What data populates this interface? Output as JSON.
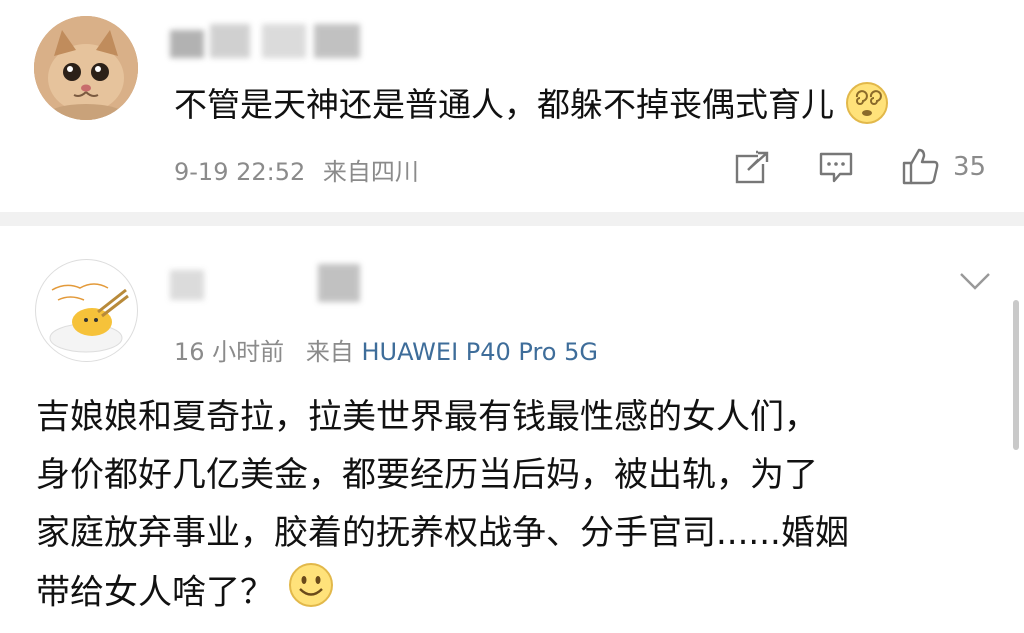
{
  "post1": {
    "comment": "不管是天神还是普通人，都躲不掉丧偶式育儿",
    "time": "9-19 22:52",
    "source": "来自四川",
    "likes": "35"
  },
  "post2": {
    "time": "16 小时前",
    "source_prefix": "来自",
    "device": "HUAWEI P40 Pro 5G",
    "lines": [
      "吉娘娘和夏奇拉，拉美世界最有钱最性感的女人们，",
      "身价都好几亿美金，都要经历当后妈，被出轨，为了",
      "家庭放弃事业，胶着的抚养权战争、分手官司......婚姻",
      "带给女人啥了？"
    ]
  },
  "icons": {
    "avatar1": "cat-avatar-icon",
    "avatar2": "egg-character-avatar-icon",
    "emoji1": "dizzy-face-emoji-icon",
    "emoji2": "smile-emoji-icon",
    "share": "share-icon",
    "comment": "comment-icon",
    "like": "thumbs-up-icon",
    "more": "chevron-down-icon"
  },
  "colors": {
    "link": "#3e6d9a",
    "meta": "#8b8b8b",
    "separator": "#f1f1f1"
  }
}
